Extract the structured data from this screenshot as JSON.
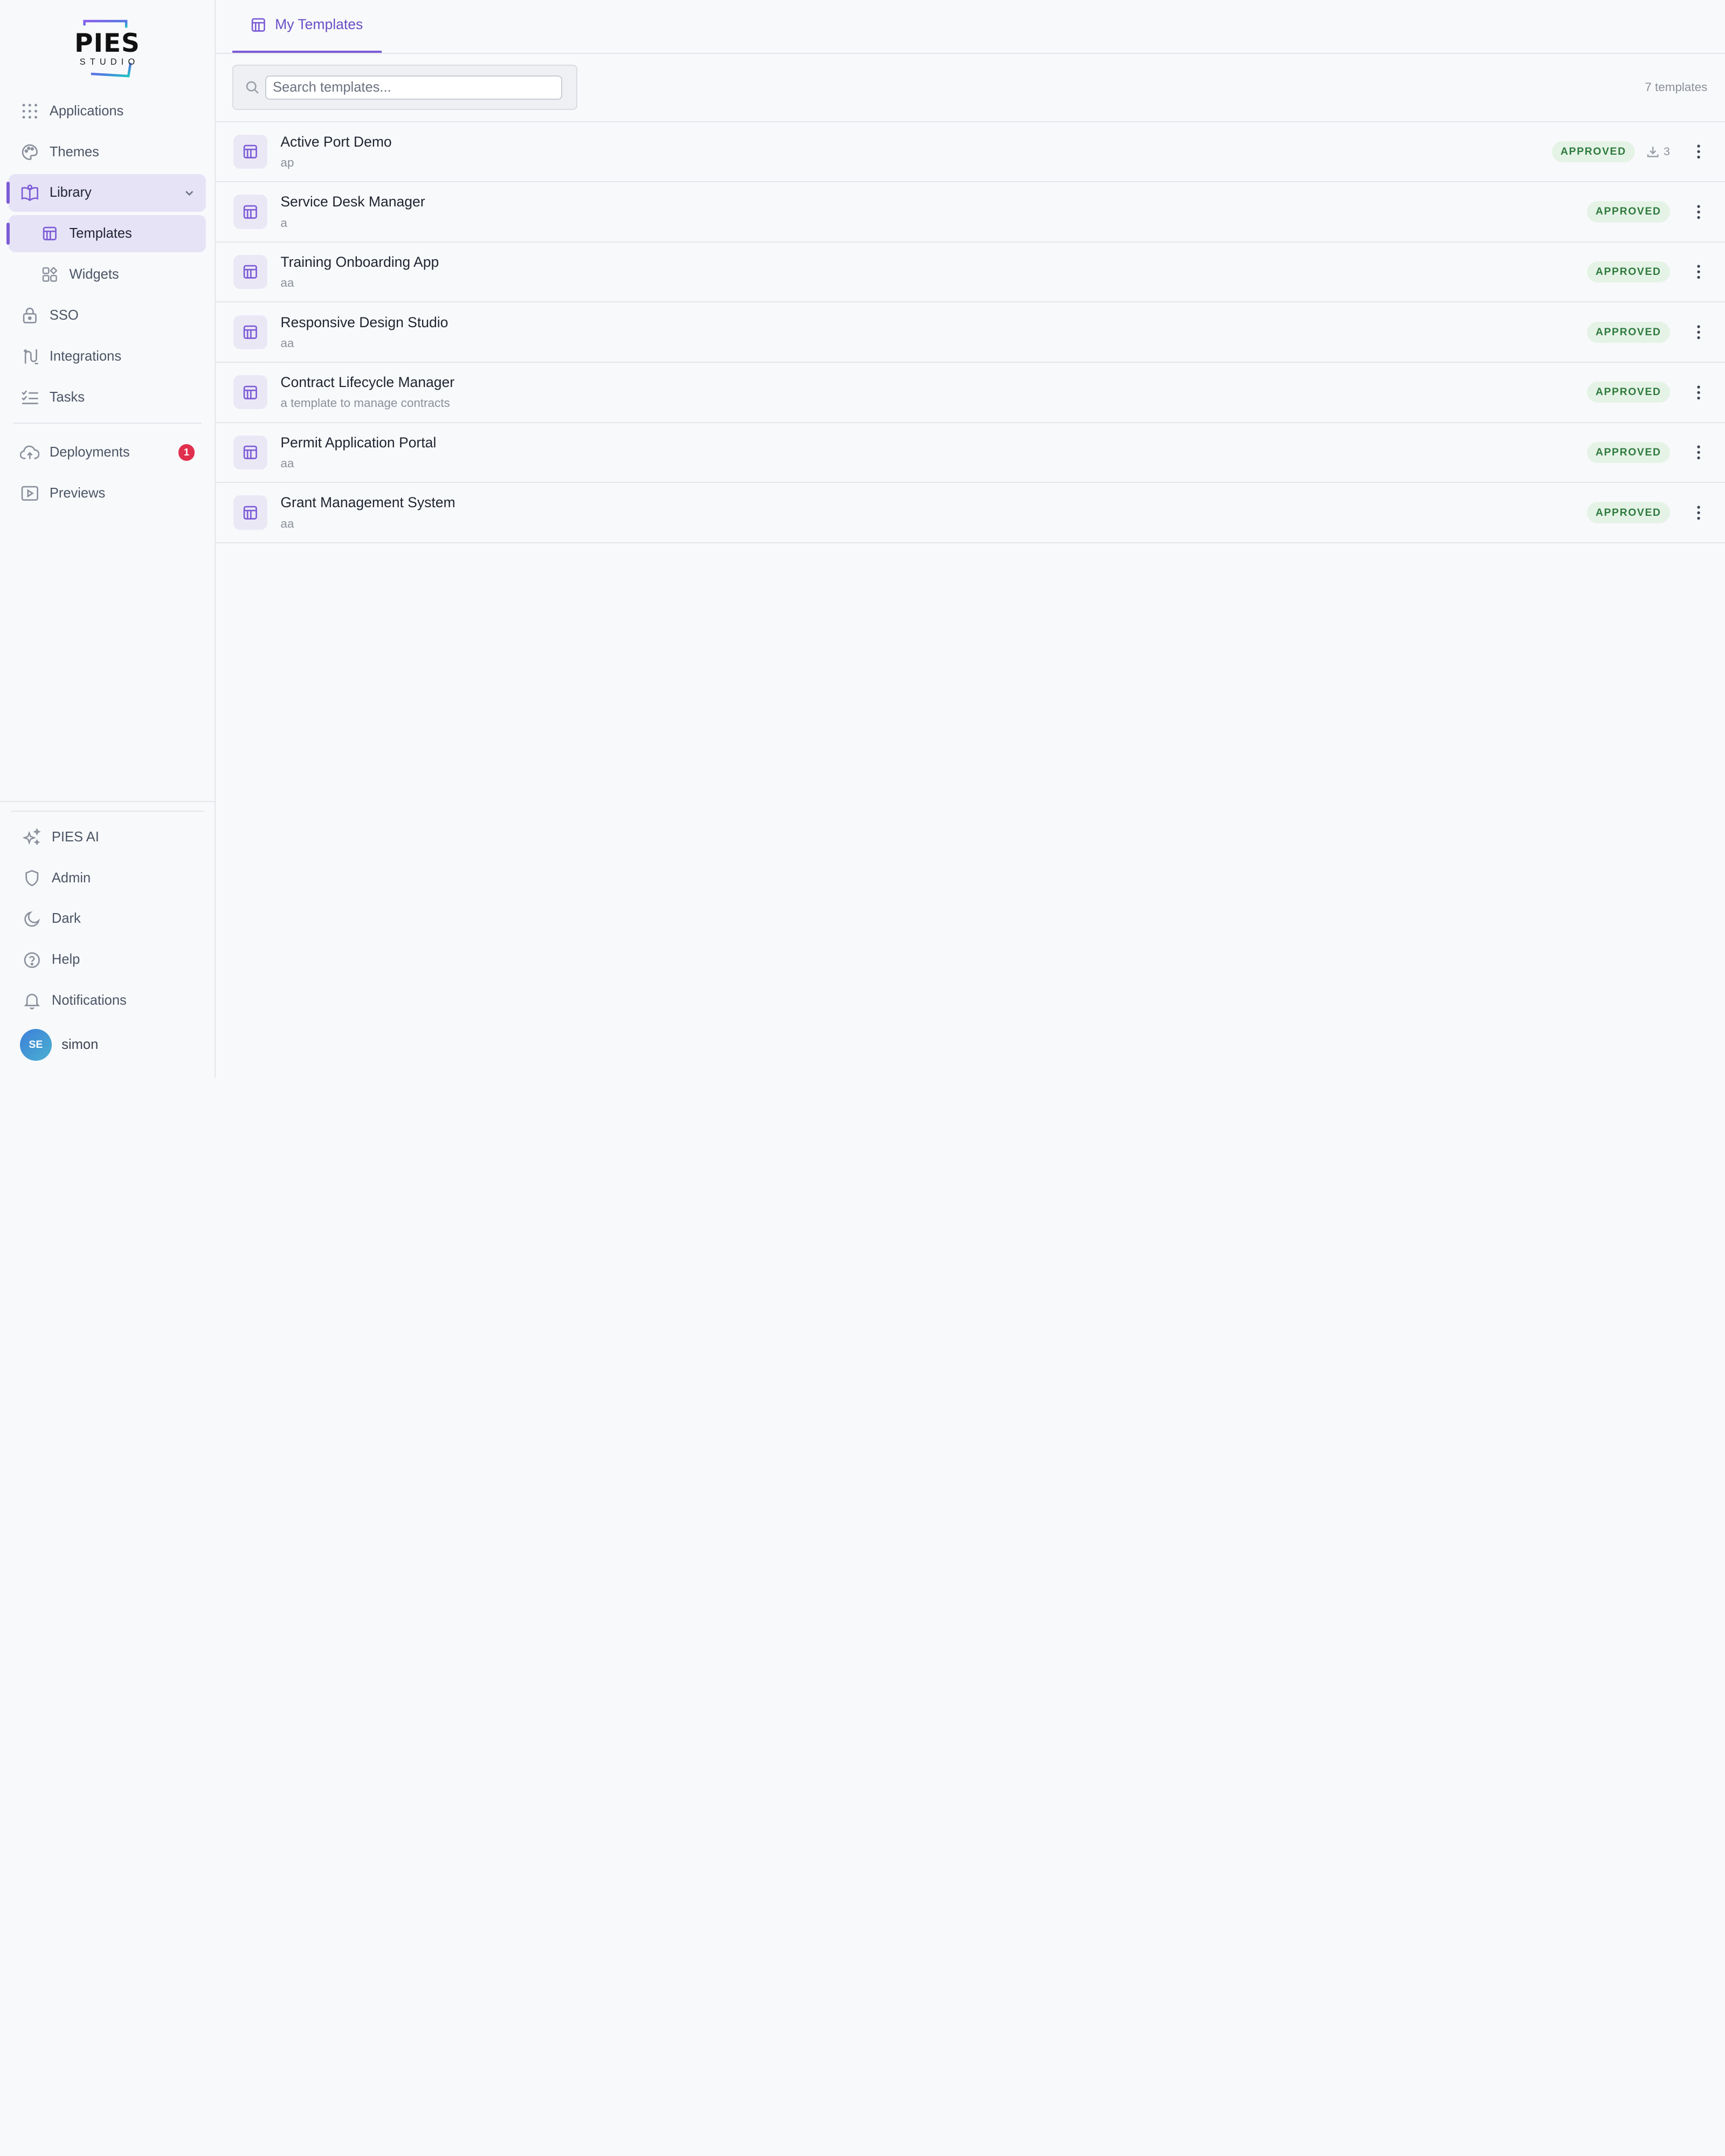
{
  "brand": {
    "logo_text": "PIES",
    "logo_sub": "STUDIO",
    "accent": "#7c5cd6"
  },
  "sidebar": {
    "items": [
      {
        "label": "Applications",
        "icon": "grid-dots-icon"
      },
      {
        "label": "Themes",
        "icon": "palette-icon"
      },
      {
        "label": "Library",
        "icon": "book-open-icon",
        "expanded": true
      },
      {
        "label": "Templates",
        "icon": "template-icon",
        "active": true
      },
      {
        "label": "Widgets",
        "icon": "widgets-icon"
      },
      {
        "label": "SSO",
        "icon": "lock-icon"
      },
      {
        "label": "Integrations",
        "icon": "integration-icon"
      },
      {
        "label": "Tasks",
        "icon": "checklist-icon"
      },
      {
        "label": "Deployments",
        "icon": "cloud-upload-icon",
        "badge": "1"
      },
      {
        "label": "Previews",
        "icon": "play-square-icon"
      }
    ],
    "bottom_items": [
      {
        "label": "PIES AI",
        "icon": "sparkles-icon"
      },
      {
        "label": "Admin",
        "icon": "shield-icon"
      },
      {
        "label": "Dark",
        "icon": "moon-icon"
      },
      {
        "label": "Help",
        "icon": "help-circle-icon"
      },
      {
        "label": "Notifications",
        "icon": "bell-icon"
      }
    ],
    "user": {
      "initials": "SE",
      "name": "simon"
    }
  },
  "main": {
    "tab": {
      "label": "My Templates",
      "icon": "template-icon"
    },
    "search": {
      "placeholder": "Search templates..."
    },
    "count_label": "7 templates",
    "templates": [
      {
        "title": "Active Port Demo",
        "desc": "ap",
        "status": "APPROVED",
        "downloads": "3"
      },
      {
        "title": "Service Desk Manager",
        "desc": "a",
        "status": "APPROVED"
      },
      {
        "title": "Training Onboarding App",
        "desc": "aa",
        "status": "APPROVED"
      },
      {
        "title": "Responsive Design Studio",
        "desc": "aa",
        "status": "APPROVED"
      },
      {
        "title": "Contract Lifecycle Manager",
        "desc": "a template to manage contracts",
        "status": "APPROVED"
      },
      {
        "title": "Permit Application Portal",
        "desc": "aa",
        "status": "APPROVED"
      },
      {
        "title": "Grant Management System",
        "desc": "aa",
        "status": "APPROVED"
      }
    ]
  }
}
